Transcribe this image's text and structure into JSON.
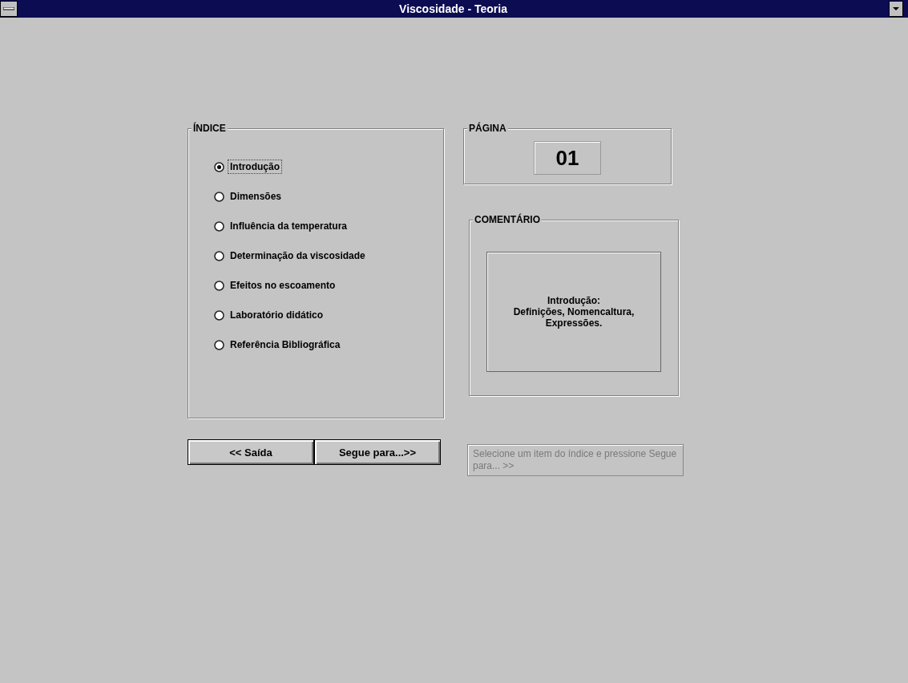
{
  "window": {
    "title": "Viscosidade - Teoria"
  },
  "index": {
    "title": "ÍNDICE",
    "items": [
      {
        "label": "Introdução",
        "selected": true
      },
      {
        "label": "Dimensões",
        "selected": false
      },
      {
        "label": "Influência da temperatura",
        "selected": false
      },
      {
        "label": "Determinação da viscosidade",
        "selected": false
      },
      {
        "label": "Efeitos no escoamento",
        "selected": false
      },
      {
        "label": "Laboratório didático",
        "selected": false
      },
      {
        "label": "Referência Bibliográfica",
        "selected": false
      }
    ]
  },
  "buttons": [
    "<< Saída",
    "Segue para...>>"
  ],
  "page": {
    "title": "PÁGINA",
    "number": "01"
  },
  "comment": {
    "title": "COMENTÁRIO",
    "lines": [
      "Introdução:",
      "Definições, Nomencaltura,",
      "Expressões."
    ]
  },
  "hint": "Selecione um item do índice e pressione Segue para... >>"
}
